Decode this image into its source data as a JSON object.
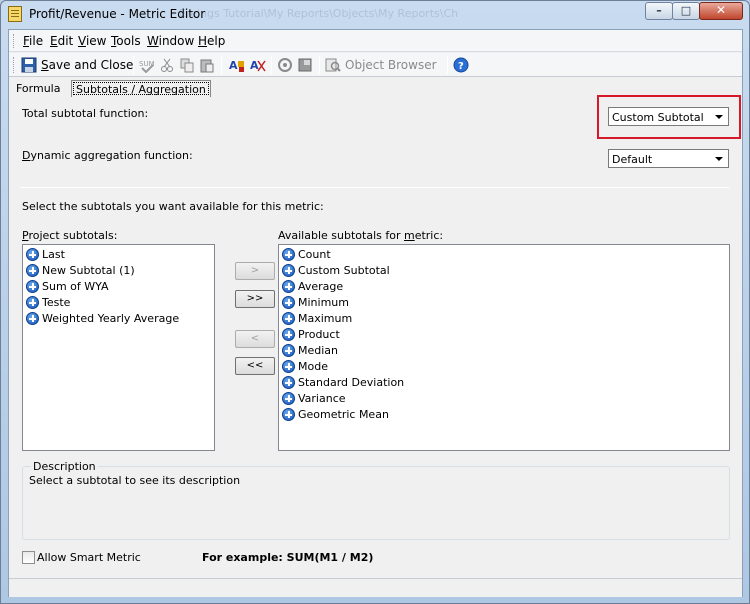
{
  "window": {
    "title": "Profit/Revenue - Metric Editor",
    "ghost_title": "Ereings Tutorial\\My Reports\\Objects\\My Reports\\Ch",
    "minimize_glyph": "–",
    "maximize_glyph": "□",
    "close_glyph": "✕"
  },
  "menu": {
    "items": [
      {
        "pre": "",
        "u": "F",
        "post": "ile"
      },
      {
        "pre": "",
        "u": "E",
        "post": "dit"
      },
      {
        "pre": "",
        "u": "V",
        "post": "iew"
      },
      {
        "pre": "",
        "u": "T",
        "post": "ools"
      },
      {
        "pre": "",
        "u": "W",
        "post": "indow"
      },
      {
        "pre": "",
        "u": "H",
        "post": "elp"
      }
    ]
  },
  "toolbar": {
    "save_close_label": "Save and Close",
    "object_browser_label": "Object Browser",
    "save_close_u": "S",
    "save_close_rest": "ave and Close"
  },
  "tabs": {
    "formula": "Formula",
    "subtotals": "Subtotals / Aggregation"
  },
  "form": {
    "total_subtotal_label": "Total subtotal function:",
    "total_subtotal_value": "Custom Subtotal",
    "dynamic_agg_label_u": "D",
    "dynamic_agg_label_rest": "ynamic aggregation function:",
    "dynamic_agg_value": "Default",
    "instructions": "Select the subtotals you want available for this metric:",
    "project_label_u": "P",
    "project_label_rest": "roject subtotals:",
    "available_label_pre": "Available subtotals for ",
    "available_label_u": "m",
    "available_label_post": "etric:",
    "highlight_color": "#d61a2a"
  },
  "project_subtotals": [
    "Last",
    "New Subtotal (1)",
    "Sum of WYA",
    "Teste",
    "Weighted Yearly Average"
  ],
  "available_subtotals": [
    "Count",
    "Custom Subtotal",
    "Average",
    "Minimum",
    "Maximum",
    "Product",
    "Median",
    "Mode",
    "Standard Deviation",
    "Variance",
    "Geometric Mean"
  ],
  "move_buttons": {
    "add_one": ">",
    "add_all": ">>",
    "remove_one": "<",
    "remove_all": "<<"
  },
  "description": {
    "title": "Description",
    "text": "Select a subtotal to see its description"
  },
  "footer": {
    "smart_metric_label": "Allow Smart Metric",
    "example_text": "For example: SUM(M1 / M2)"
  }
}
